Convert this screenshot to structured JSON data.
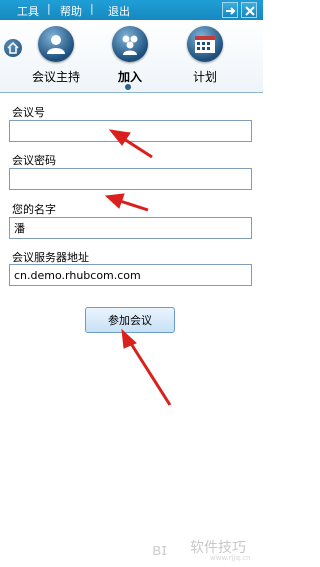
{
  "menu": {
    "tools": "工具",
    "help": "帮助",
    "exit": "退出",
    "separator": "|"
  },
  "tabs": [
    {
      "label": "会议主持",
      "icon": "person-icon"
    },
    {
      "label": "加入",
      "icon": "group-icon",
      "active": true
    },
    {
      "label": "计划",
      "icon": "calendar-icon"
    }
  ],
  "form": {
    "meeting_id_label": "会议号",
    "meeting_id_value": "",
    "meeting_password_label": "会议密码",
    "meeting_password_value": "",
    "your_name_label": "您的名字",
    "your_name_value": "潘",
    "server_label": "会议服务器地址",
    "server_value": "cn.demo.rhubcom.com",
    "join_button": "参加会议"
  },
  "watermark": {
    "text": "软件技巧",
    "sub": "www.rjjq.cn"
  },
  "colors": {
    "titlebar": "#1689c0",
    "annotation_arrow": "#d9201c"
  }
}
